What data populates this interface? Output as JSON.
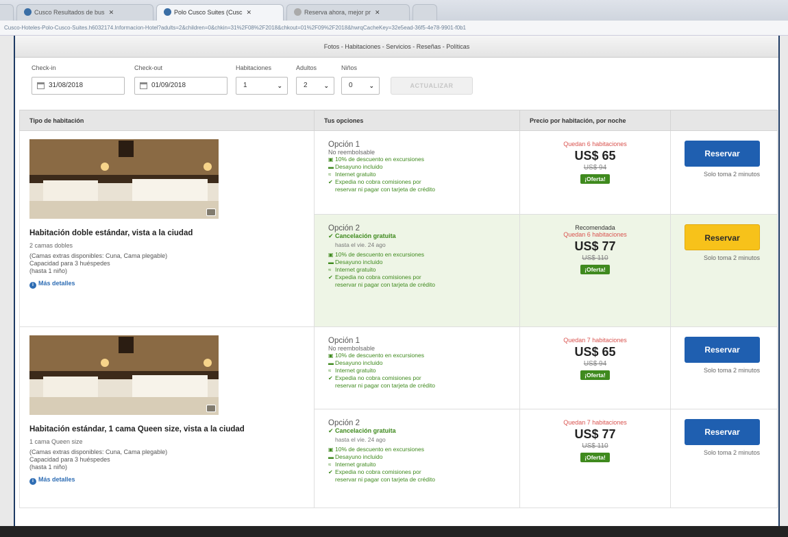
{
  "browser": {
    "tabs": [
      {
        "label": "Cusco Resultados de bus"
      },
      {
        "label": "Polo Cusco Suites (Cusc"
      },
      {
        "label": "Reserva ahora, mejor pr"
      }
    ],
    "close_glyph": "✕",
    "address": "Cusco-Hoteles-Polo-Cusco-Suites.h6032174.Informacion-Hotel?adults=2&children=0&chkin=31%2F08%2F2018&chkout=01%2F09%2F2018&hwrqCacheKey=32e5ead-36f5-4e78-9901-f0b1"
  },
  "subnav": {
    "text": "Fotos - Habitaciones - Servicios - Reseñas - Políticas"
  },
  "search": {
    "checkin_label": "Check-in",
    "checkin_value": "31/08/2018",
    "checkout_label": "Check-out",
    "checkout_value": "01/09/2018",
    "rooms_label": "Habitaciones",
    "rooms_value": "1",
    "adults_label": "Adultos",
    "adults_value": "2",
    "children_label": "Niños",
    "children_value": "0",
    "update_label": "ACTUALIZAR"
  },
  "table": {
    "headers": [
      "Tipo de habitación",
      "Tus opciones",
      "Precio por habitación, por noche",
      ""
    ],
    "rooms": [
      {
        "name": "Habitación doble estándar, vista a la ciudad",
        "beds": "2 camas dobles",
        "extra": "(Camas extras disponibles: Cuna, Cama plegable)",
        "capacity": "Capacidad para 3 huéspedes",
        "capacity_note": "(hasta 1 niño)",
        "more": "Más detalles",
        "options": [
          {
            "title": "Opción 1",
            "policy": "No reembolsable",
            "features": [
              "10% de descuento en excursiones",
              "Desayuno incluido",
              "Internet gratuito",
              "Expedia no cobra comisiones por",
              "reservar ni pagar con tarjeta de crédito"
            ],
            "left": "Quedan 6 habitaciones",
            "price": "US$ 65",
            "old_price": "US$ 94",
            "offer": "¡Oferta!",
            "book": "Reservar",
            "note": "Solo toma 2 minutos"
          },
          {
            "title": "Opción 2",
            "policy": "Cancelación gratuita",
            "until": "hasta el vie. 24 ago",
            "features": [
              "10% de descuento en excursiones",
              "Desayuno incluido",
              "Internet gratuito",
              "Expedia no cobra comisiones por",
              "reservar ni pagar con tarjeta de crédito"
            ],
            "recommended": "Recomendada",
            "left": "Quedan 6 habitaciones",
            "price": "US$ 77",
            "old_price": "US$ 110",
            "offer": "¡Oferta!",
            "book": "Reservar",
            "note": "Solo toma 2 minutos"
          }
        ]
      },
      {
        "name": "Habitación estándar, 1 cama Queen size, vista a la ciudad",
        "beds": "1 cama Queen size",
        "extra": "(Camas extras disponibles: Cuna, Cama plegable)",
        "capacity": "Capacidad para 3 huéspedes",
        "capacity_note": "(hasta 1 niño)",
        "more": "Más detalles",
        "options": [
          {
            "title": "Opción 1",
            "policy": "No reembolsable",
            "features": [
              "10% de descuento en excursiones",
              "Desayuno incluido",
              "Internet gratuito",
              "Expedia no cobra comisiones por",
              "reservar ni pagar con tarjeta de crédito"
            ],
            "left": "Quedan 7 habitaciones",
            "price": "US$ 65",
            "old_price": "US$ 94",
            "offer": "¡Oferta!",
            "book": "Reservar",
            "note": "Solo toma 2 minutos"
          },
          {
            "title": "Opción 2",
            "policy": "Cancelación gratuita",
            "until": "hasta el vie. 24 ago",
            "features": [
              "10% de descuento en excursiones",
              "Desayuno incluido",
              "Internet gratuito",
              "Expedia no cobra comisiones por",
              "reservar ni pagar con tarjeta de crédito"
            ],
            "left": "Quedan 7 habitaciones",
            "price": "US$ 77",
            "old_price": "US$ 110",
            "offer": "¡Oferta!",
            "book": "Reservar",
            "note": "Solo toma 2 minutos"
          }
        ]
      }
    ]
  },
  "colors": {
    "brand_blue": "#1f5fb0",
    "accent_yellow": "#f7c21a",
    "offer_green": "#3f8a1e",
    "alert_red": "#d9534f"
  },
  "icons": {
    "feature_icons": [
      "gift-icon",
      "coffee-icon",
      "wifi-icon",
      "check-icon",
      "check-icon"
    ],
    "cancel_icon": "check-icon"
  }
}
